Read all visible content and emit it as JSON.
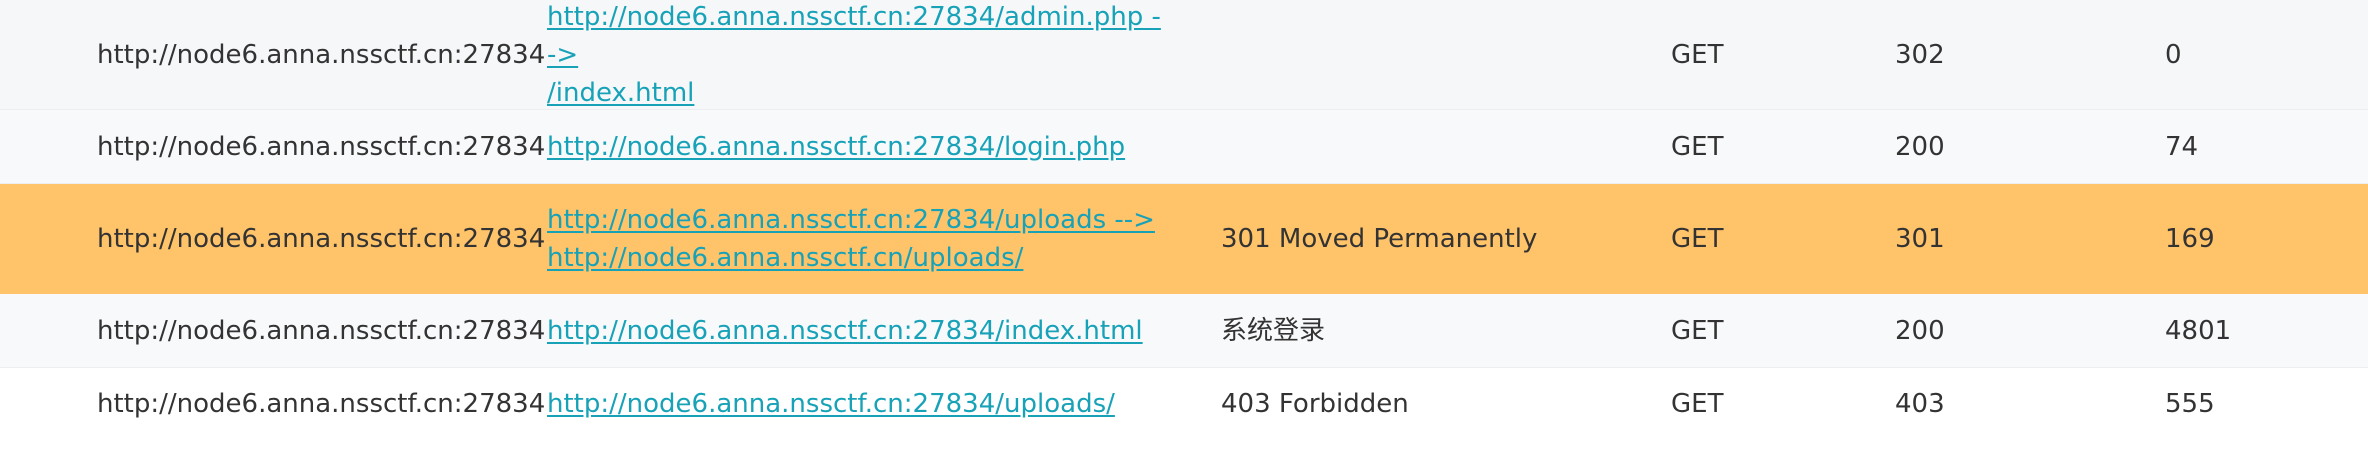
{
  "rows": [
    {
      "host": "http://node6.anna.nssctf.cn:27834",
      "url_line1": "http://node6.anna.nssctf.cn:27834/admin.php -->",
      "url_line2": "/index.html",
      "title": "",
      "method": "GET",
      "status": "302",
      "size": "0"
    },
    {
      "host": "http://node6.anna.nssctf.cn:27834",
      "url_line1": "http://node6.anna.nssctf.cn:27834/login.php",
      "url_line2": "",
      "title": "",
      "method": "GET",
      "status": "200",
      "size": "74"
    },
    {
      "host": "http://node6.anna.nssctf.cn:27834",
      "url_line1": "http://node6.anna.nssctf.cn:27834/uploads -->",
      "url_line2": "http://node6.anna.nssctf.cn/uploads/",
      "title": "301 Moved Permanently",
      "method": "GET",
      "status": "301",
      "size": "169",
      "highlight_color": "#ffc36a"
    },
    {
      "host": "http://node6.anna.nssctf.cn:27834",
      "url_line1": "http://node6.anna.nssctf.cn:27834/index.html",
      "url_line2": "",
      "title": "系统登录",
      "method": "GET",
      "status": "200",
      "size": "4801"
    },
    {
      "host": "http://node6.anna.nssctf.cn:27834",
      "url_line1": "http://node6.anna.nssctf.cn:27834/uploads/",
      "url_line2": "",
      "title": "403 Forbidden",
      "method": "GET",
      "status": "403",
      "size": "555"
    }
  ],
  "colors": {
    "link": "#17a2b8",
    "text": "#333333",
    "highlight": "#ffc36a"
  }
}
